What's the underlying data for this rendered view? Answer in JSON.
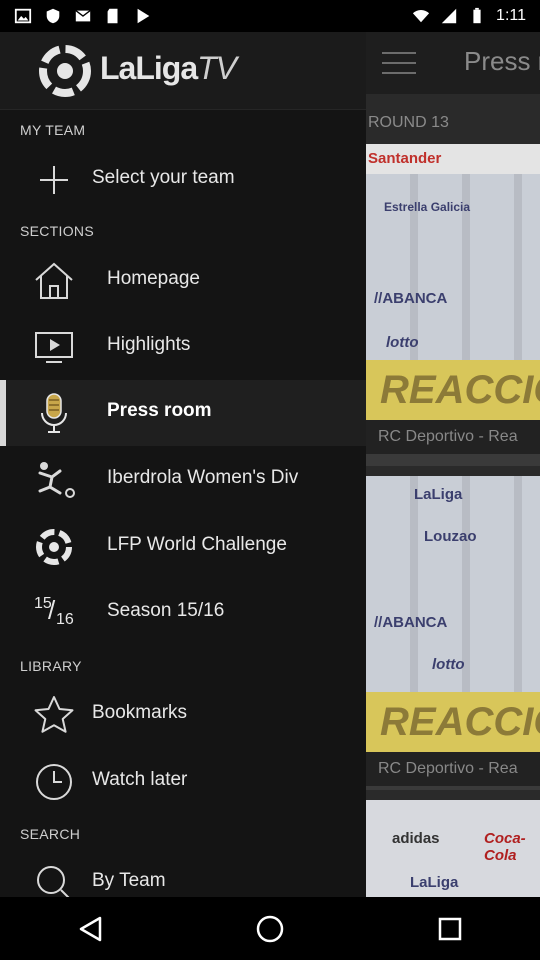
{
  "status_bar": {
    "time": "1:11"
  },
  "drawer": {
    "brand": {
      "name": "LaLiga",
      "suffix": "TV"
    },
    "my_team": {
      "heading": "MY TEAM",
      "select_label": "Select your team"
    },
    "sections": {
      "heading": "SECTIONS",
      "items": [
        {
          "label": "Homepage",
          "icon": "home-icon"
        },
        {
          "label": "Highlights",
          "icon": "tv-play-icon"
        },
        {
          "label": "Press room",
          "icon": "microphone-icon",
          "selected": true
        },
        {
          "label": "Iberdrola Women's Div",
          "icon": "player-kick-icon"
        },
        {
          "label": "LFP World Challenge",
          "icon": "laliga-ball-icon"
        },
        {
          "label": "Season 15/16",
          "icon": "season-icon",
          "season_a": "15",
          "season_b": "16"
        }
      ]
    },
    "library": {
      "heading": "LIBRARY",
      "items": [
        {
          "label": "Bookmarks",
          "icon": "star-icon"
        },
        {
          "label": "Watch later",
          "icon": "clock-icon"
        }
      ]
    },
    "search": {
      "heading": "SEARCH",
      "items": [
        {
          "label": "By Team",
          "icon": "search-icon"
        }
      ]
    }
  },
  "background": {
    "title": "Press r",
    "round": "ROUND 13",
    "cards": [
      {
        "banner": "REACCIO",
        "caption": "RC Deportivo - Rea"
      },
      {
        "banner": "REACCIO",
        "caption": "RC Deportivo - Rea"
      }
    ],
    "sponsor_texts": [
      "Santander",
      "Estrella Galicia",
      "//ABANCA",
      "lotto",
      "LaLiga",
      "Louzao",
      "adidas",
      "Coca-Cola"
    ]
  }
}
